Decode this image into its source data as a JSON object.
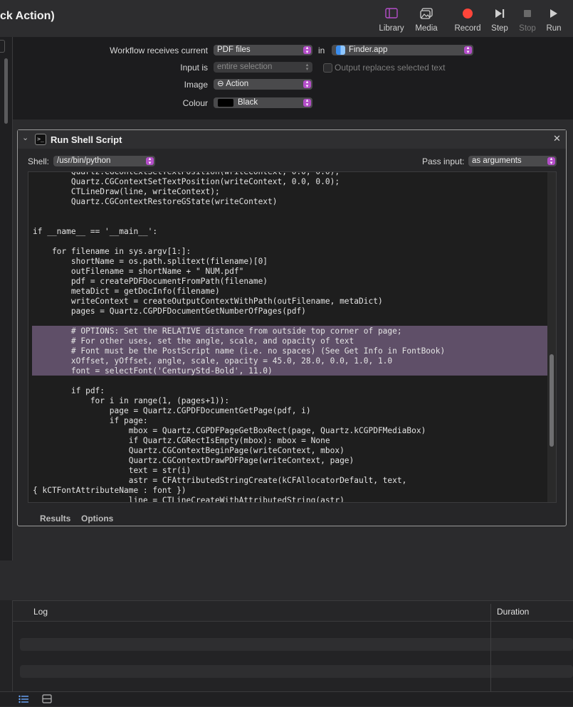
{
  "window": {
    "title": "ck Action)"
  },
  "toolbar": {
    "library": "Library",
    "media": "Media",
    "record": "Record",
    "step": "Step",
    "stop": "Stop",
    "run": "Run"
  },
  "workflow": {
    "receives_label": "Workflow receives current",
    "receives_value": "PDF files",
    "in_label": "in",
    "in_value": "Finder.app",
    "input_is_label": "Input is",
    "input_is_value": "entire selection",
    "output_replaces_label": "Output replaces selected text",
    "image_label": "Image",
    "image_value": "⊖ Action",
    "colour_label": "Colour",
    "colour_value": "Black",
    "colour_swatch": "#000000"
  },
  "action": {
    "title": "Run Shell Script",
    "shell_label": "Shell:",
    "shell_value": "/usr/bin/python",
    "pass_input_label": "Pass input:",
    "pass_input_value": "as arguments",
    "tab_results": "Results",
    "tab_options": "Options",
    "code": "        Quartz.CGContextSetTextPosition(writeContext, 0.0, 0.0);\n        Quartz.CGContextSetTextPosition(writeContext, 0.0, 0.0);\n        CTLineDraw(line, writeContext);\n        Quartz.CGContextRestoreGState(writeContext)\n\n\nif __name__ == '__main__':\n\n    for filename in sys.argv[1:]:\n        shortName = os.path.splitext(filename)[0]\n        outFilename = shortName + \" NUM.pdf\"\n        pdf = createPDFDocumentFromPath(filename)\n        metaDict = getDocInfo(filename)\n        writeContext = createOutputContextWithPath(outFilename, metaDict)\n        pages = Quartz.CGPDFDocumentGetNumberOfPages(pdf)\n\n        # OPTIONS: Set the RELATIVE distance from outside top corner of page;\n        # For other uses, set the angle, scale, and opacity of text\n        # Font must be the PostScript name (i.e. no spaces) (See Get Info in FontBook)\n        xOffset, yOffset, angle, scale, opacity = 45.0, 28.0, 0.0, 1.0, 1.0\n        font = selectFont('CenturyStd-Bold', 11.0)\n\n        if pdf:\n            for i in range(1, (pages+1)):\n                page = Quartz.CGPDFDocumentGetPage(pdf, i)\n                if page:\n                    mbox = Quartz.CGPDFPageGetBoxRect(page, Quartz.kCGPDFMediaBox)\n                    if Quartz.CGRectIsEmpty(mbox): mbox = None\n                    Quartz.CGContextBeginPage(writeContext, mbox)\n                    Quartz.CGContextDrawPDFPage(writeContext, page)\n                    text = str(i)\n                    astr = CFAttributedStringCreate(kCFAllocatorDefault, text,\n{ kCTFontAttributeName : font })\n                    line = CTLineCreateWithAttributedString(astr)"
  },
  "log": {
    "col_log": "Log",
    "col_duration": "Duration"
  },
  "colors": {
    "accent": "#b44ec9",
    "record": "#ff453a",
    "highlight": "#5f4f68"
  }
}
